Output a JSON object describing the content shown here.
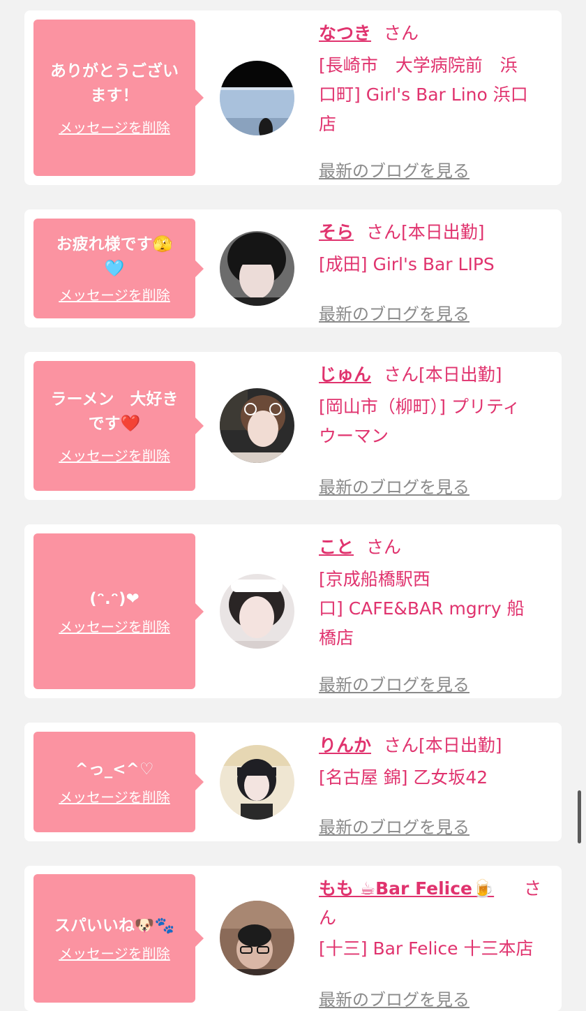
{
  "common": {
    "delete_label": "メッセージを削除",
    "blog_label": "最新のブログを見る",
    "san_suffix": "さん",
    "colors": {
      "page_bg": "#f2f2f2",
      "card_bg": "#ffffff",
      "bubble_bg": "#fb93a1",
      "accent": "#e0336e",
      "muted": "#8a8a8a"
    }
  },
  "entries": [
    {
      "message_lines": [
        "ありがとうござい",
        "ます！"
      ],
      "name": "なつき",
      "san": "さん",
      "status": "",
      "shop_lines": [
        "[長崎市　大学病院前　浜",
        "口町] Girl's Bar Lino 浜口",
        "店"
      ]
    },
    {
      "message_lines": [
        "お疲れ様です🫣",
        "🩵"
      ],
      "name": "そら",
      "san": "さん",
      "status": "[本日出勤]",
      "shop_lines": [
        "[成田] Girl's Bar LIPS"
      ]
    },
    {
      "message_lines": [
        "ラーメン　大好き",
        "です❤️"
      ],
      "name": "じゅん",
      "san": "さん",
      "status": "[本日出勤]",
      "shop_lines": [
        "[岡山市（柳町）] プリティ",
        "ウーマン"
      ]
    },
    {
      "message_lines": [
        "(ᵔ.ᵔ)❤"
      ],
      "name": "こと",
      "san": "さん",
      "status": "",
      "shop_lines": [
        "[京成船橋駅西",
        "口] CAFE&BAR mgrry 船",
        "橋店"
      ]
    },
    {
      "message_lines": [
        "^っ_<^♡"
      ],
      "name": "りんか",
      "san": "さん",
      "status": "[本日出勤]",
      "shop_lines": [
        "[名古屋 錦] 乙女坂42"
      ]
    },
    {
      "message_lines": [
        "スパいいね🐶🐾"
      ],
      "name": "もも ☕Bar Felice🍺",
      "san": "さ",
      "san_line2": "ん",
      "status": "",
      "shop_lines": [
        "[十三] Bar Felice 十三本店"
      ]
    }
  ]
}
